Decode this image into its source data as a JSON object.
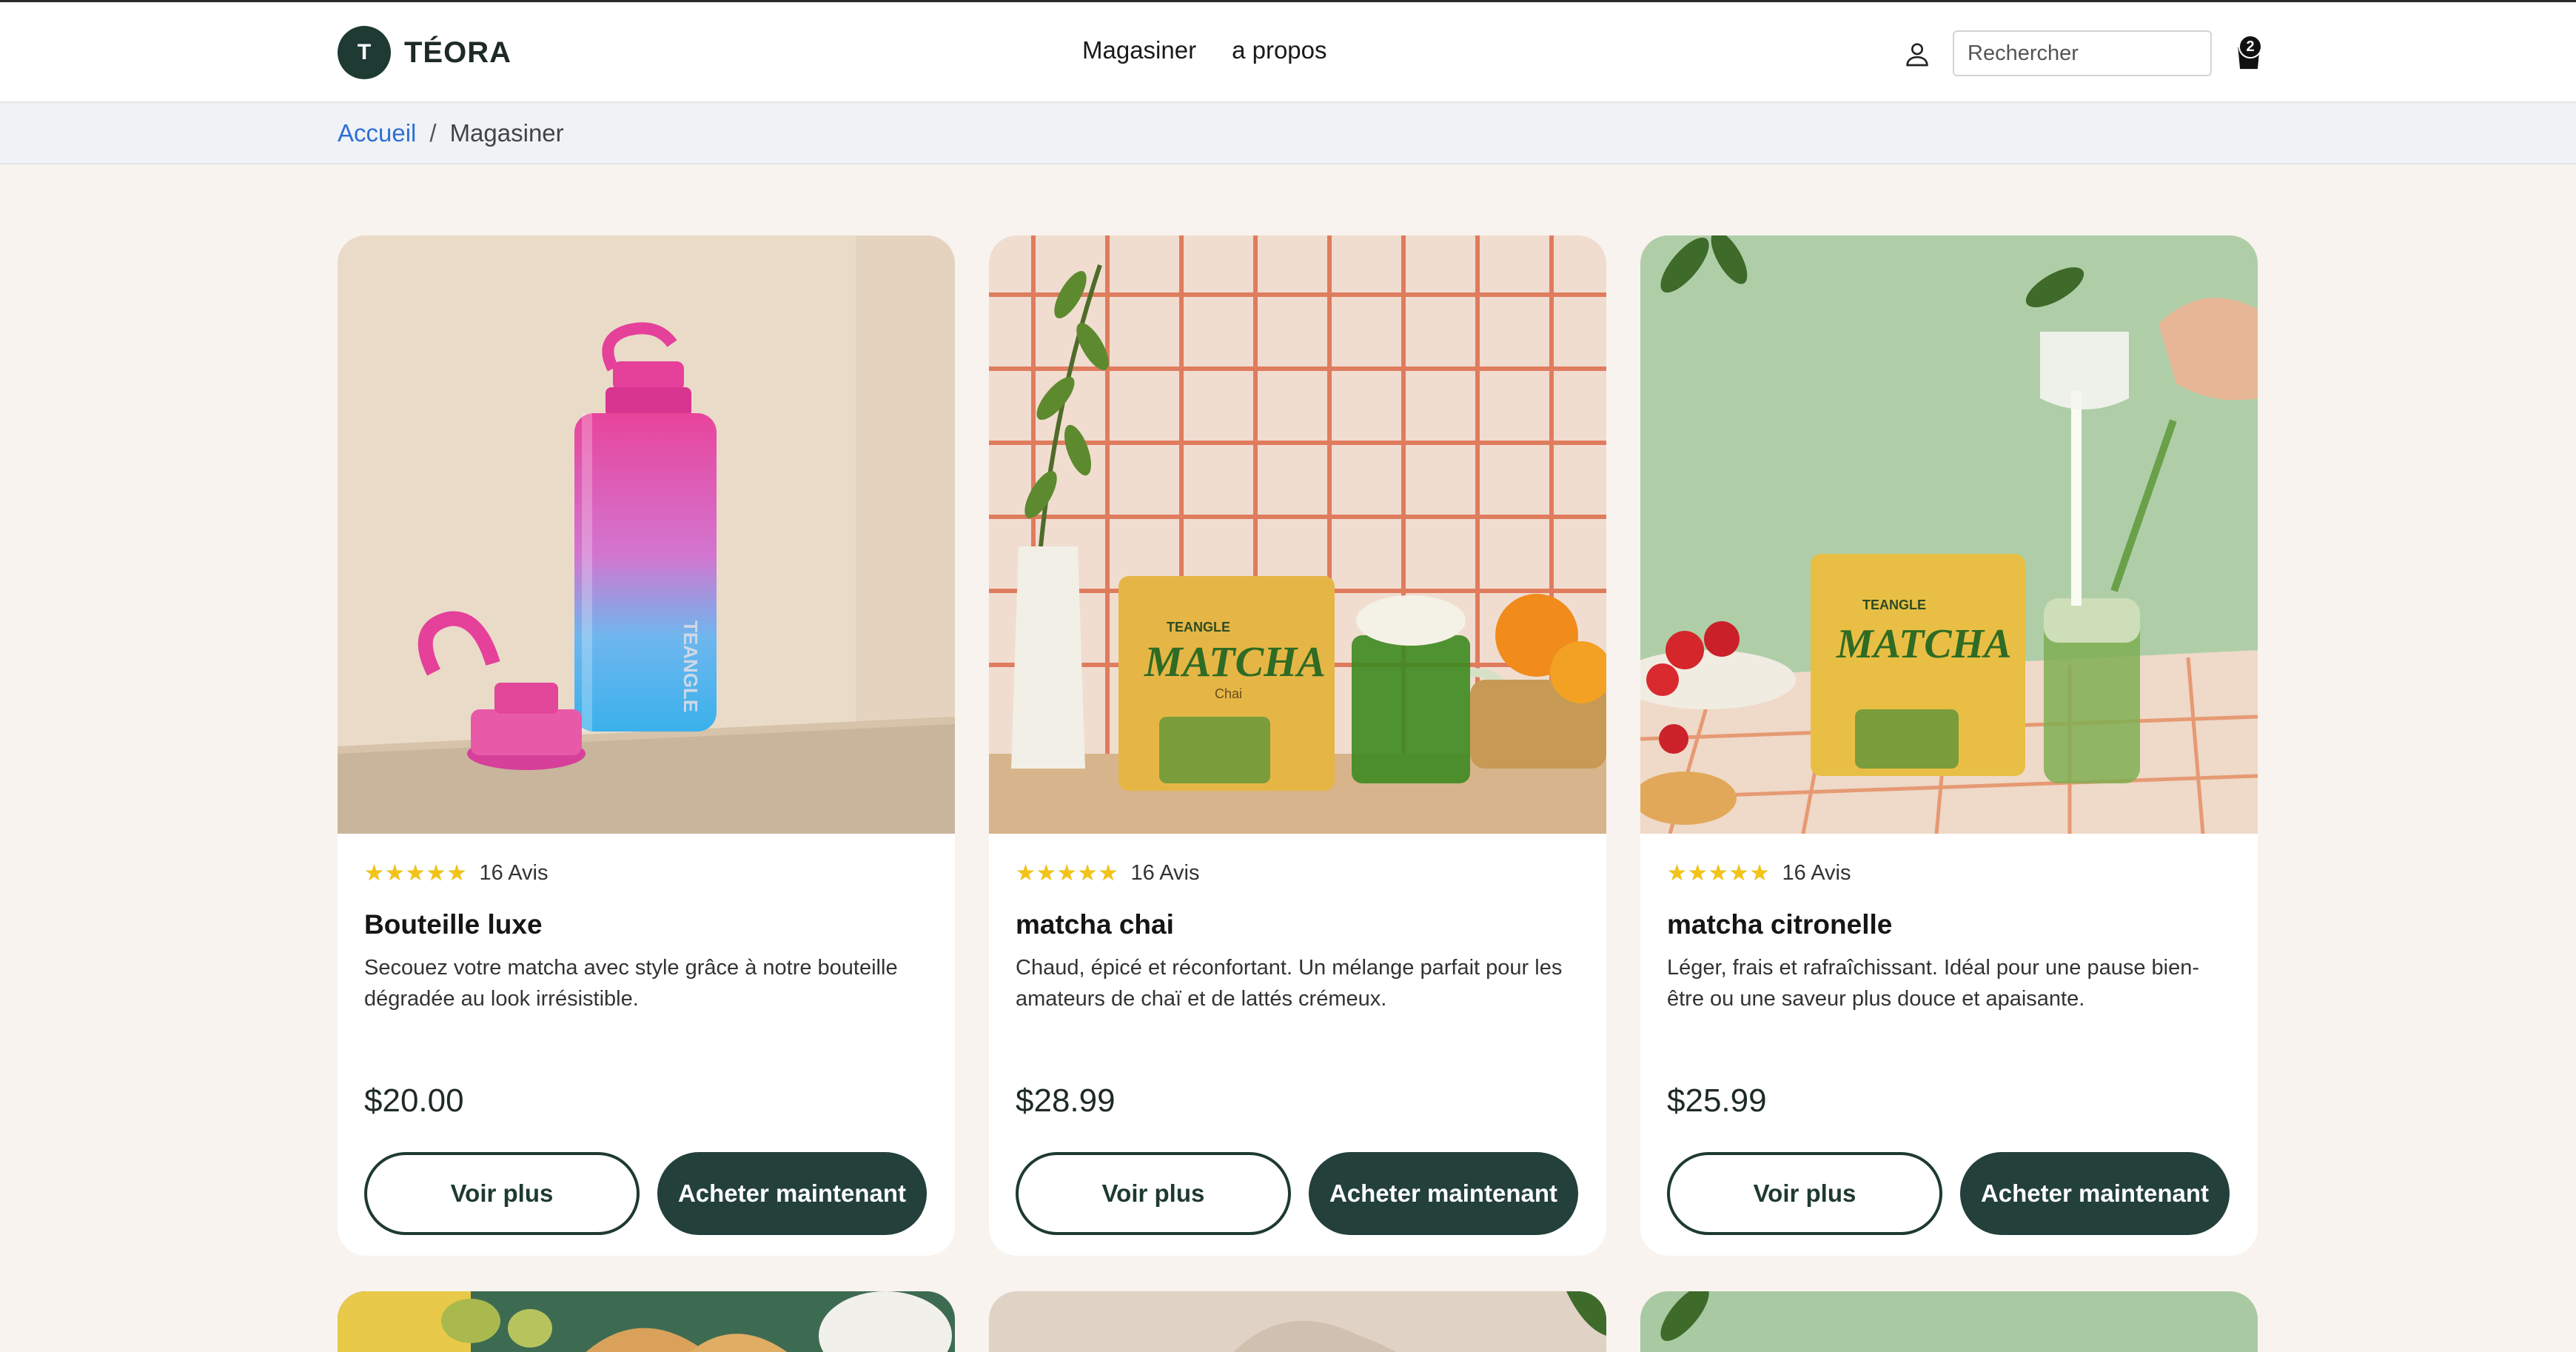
{
  "header": {
    "logo_letter": "T",
    "logo_text": "TÉORA",
    "nav": [
      "Magasiner",
      "a propos"
    ],
    "search_placeholder": "Rechercher",
    "cart_count": "2",
    "icons": [
      "user-icon",
      "shopping-bag-icon"
    ]
  },
  "breadcrumb": {
    "home": "Accueil",
    "separator": "/",
    "current": "Magasiner"
  },
  "products": [
    {
      "stars": "★★★★★",
      "reviews": "16 Avis",
      "title": "Bouteille luxe",
      "description": "Secouez votre matcha avec style grâce à notre bouteille dégradée au look irrésistible.",
      "price": "$20.00",
      "more_label": "Voir plus",
      "buy_label": "Acheter maintenant"
    },
    {
      "stars": "★★★★★",
      "reviews": "16 Avis",
      "title": "matcha chai",
      "description": "Chaud, épicé et réconfortant. Un mélange parfait pour les amateurs de chaï et de lattés crémeux.",
      "price": "$28.99",
      "more_label": "Voir plus",
      "buy_label": "Acheter maintenant"
    },
    {
      "stars": "★★★★★",
      "reviews": "16 Avis",
      "title": "matcha citronelle",
      "description": "Léger, frais et rafraîchissant. Idéal pour une pause bien-être ou une saveur plus douce et apaisante.",
      "price": "$25.99",
      "more_label": "Voir plus",
      "buy_label": "Acheter maintenant"
    }
  ],
  "colors": {
    "brand_dark_green": "#23403a",
    "link_blue": "#2f6fd6",
    "page_bg": "#f8f3ee",
    "star_yellow": "#f2c419"
  }
}
